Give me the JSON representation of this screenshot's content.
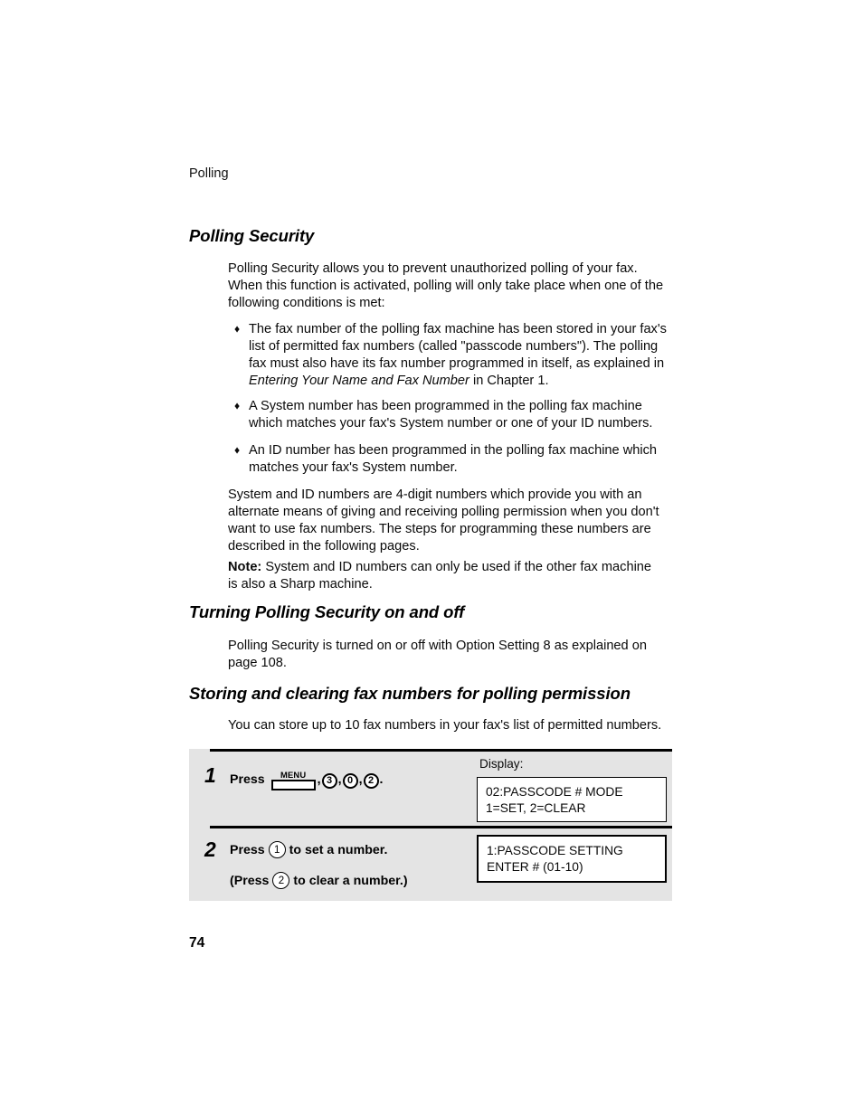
{
  "page": {
    "running_header": "Polling",
    "page_number": "74"
  },
  "sections": {
    "polling_security": {
      "heading": "Polling Security",
      "intro": "Polling Security allows you to prevent unauthorized polling of your fax. When this function is activated, polling will only take place when one of the following conditions is met:",
      "bullet_mark": "♦",
      "bullets": [
        {
          "text_before": "The fax number of the polling fax machine has been stored in your fax's list of permitted fax numbers (called \"passcode numbers\"). The polling fax must also have its fax number programmed in itself, as explained in ",
          "italic": "Entering Your Name and Fax Number",
          "text_after": " in Chapter 1."
        },
        {
          "text_before": "A System number has been programmed in the polling fax machine which matches your fax's System number or one of your ID numbers.",
          "italic": "",
          "text_after": ""
        },
        {
          "text_before": "An ID number has been programmed in the polling fax machine which matches your fax's System number.",
          "italic": "",
          "text_after": ""
        }
      ],
      "sysid_paragraph": "System and ID numbers are 4-digit numbers which provide you with an alternate means of giving and receiving polling permission when you don't want to use fax numbers. The steps for programming these numbers are described in the following pages.",
      "note_label": "Note:",
      "note_text": " System and ID numbers can only be used if the other fax machine is also a Sharp machine."
    },
    "turning_on_off": {
      "heading": "Turning Polling Security on and off",
      "paragraph": "Polling Security is turned on or off with Option Setting 8 as explained on page 108."
    },
    "storing_clearing": {
      "heading": "Storing and clearing fax numbers for polling permission",
      "paragraph": "You can store up to 10 fax numbers in your fax's list of permitted numbers."
    }
  },
  "steps": {
    "display_label": "Display:",
    "step1": {
      "number": "1",
      "press_label": "Press",
      "menu_key_label": "MENU",
      "comma": ",",
      "keys": [
        "3",
        "0",
        "2"
      ],
      "period": ".",
      "display_lines": [
        "02:PASSCODE # MODE",
        "1=SET, 2=CLEAR"
      ]
    },
    "step2": {
      "number": "2",
      "line1_press": "Press",
      "line1_key": "1",
      "line1_tail": "to set a number.",
      "line2_head": "(Press",
      "line2_key": "2",
      "line2_tail": "to clear a number.)",
      "display_lines": [
        "1:PASSCODE SETTING",
        "ENTER # (01-10)"
      ]
    }
  }
}
